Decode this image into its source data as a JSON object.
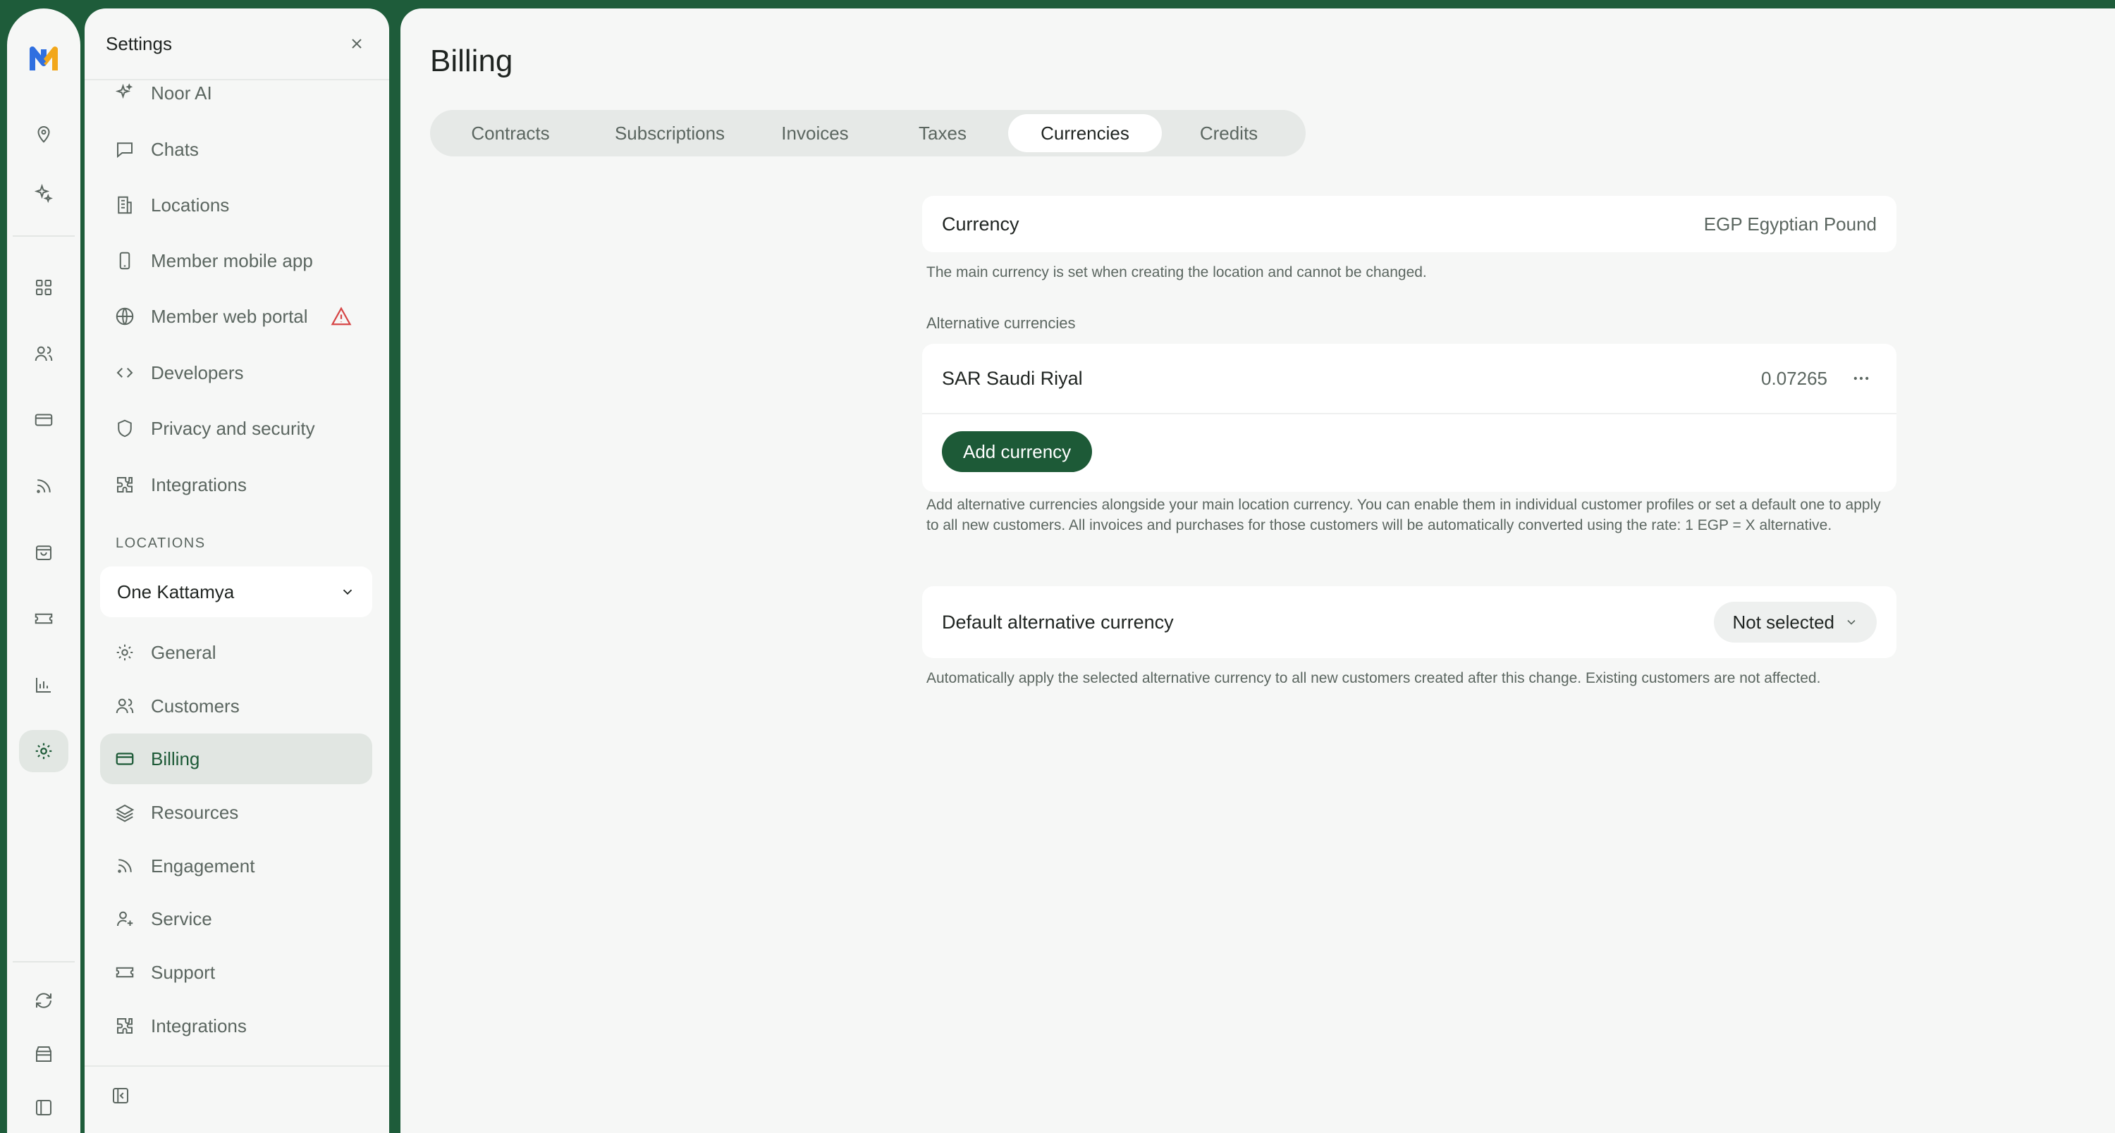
{
  "colors": {
    "brand": "#1d5a37",
    "frame": "#1e5c3a",
    "warning": "#d64545"
  },
  "settings": {
    "title": "Settings",
    "items": [
      {
        "label": "Noor AI",
        "icon": "sparkle-icon"
      },
      {
        "label": "Chats",
        "icon": "chat-icon"
      },
      {
        "label": "Locations",
        "icon": "building-icon"
      },
      {
        "label": "Member mobile app",
        "icon": "phone-icon"
      },
      {
        "label": "Member web portal",
        "icon": "globe-icon",
        "warning": true
      },
      {
        "label": "Developers",
        "icon": "code-icon"
      },
      {
        "label": "Privacy and security",
        "icon": "shield-icon"
      },
      {
        "label": "Integrations",
        "icon": "puzzle-icon"
      }
    ],
    "locations_label": "LOCATIONS",
    "location_selected": "One Kattamya",
    "location_items": [
      {
        "label": "General",
        "icon": "gear-icon"
      },
      {
        "label": "Customers",
        "icon": "users-icon"
      },
      {
        "label": "Billing",
        "icon": "card-icon",
        "active": true
      },
      {
        "label": "Resources",
        "icon": "layers-icon"
      },
      {
        "label": "Engagement",
        "icon": "rss-icon"
      },
      {
        "label": "Service",
        "icon": "user-plus-icon"
      },
      {
        "label": "Support",
        "icon": "ticket-icon"
      },
      {
        "label": "Integrations",
        "icon": "puzzle-icon"
      }
    ]
  },
  "main": {
    "title": "Billing",
    "tabs": [
      {
        "label": "Contracts"
      },
      {
        "label": "Subscriptions"
      },
      {
        "label": "Invoices"
      },
      {
        "label": "Taxes"
      },
      {
        "label": "Currencies",
        "active": true
      },
      {
        "label": "Credits"
      }
    ],
    "currency": {
      "label": "Currency",
      "value": "EGP Egyptian Pound",
      "help": "The main currency is set when creating the location and cannot be changed."
    },
    "alternative": {
      "heading": "Alternative currencies",
      "items": [
        {
          "name": "SAR Saudi Riyal",
          "rate": "0.07265"
        }
      ],
      "add_label": "Add currency",
      "help": "Add alternative currencies alongside your main location currency. You can enable them in individual customer profiles or set a default one to apply to all new customers. All invoices and purchases for those customers will be automatically converted using the rate: 1 EGP = X alternative."
    },
    "default_alt": {
      "label": "Default alternative currency",
      "value": "Not selected",
      "help": "Automatically apply the selected alternative currency to all new customers created after this change. Existing customers are not affected."
    }
  }
}
